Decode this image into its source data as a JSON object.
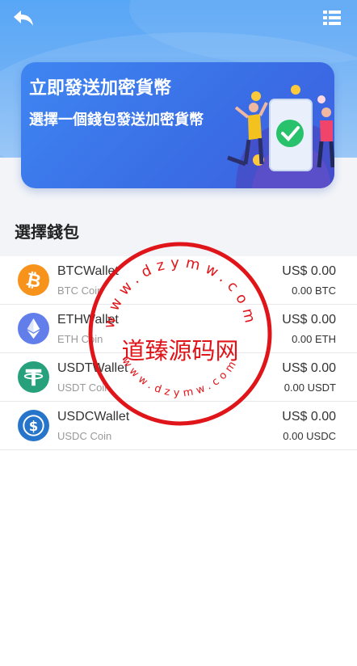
{
  "nav": {
    "back_icon": "back-arrow-icon",
    "menu_icon": "list-menu-icon"
  },
  "banner": {
    "title": "立即發送加密貨幣",
    "subtitle": "選擇一個錢包發送加密貨幣"
  },
  "section": {
    "title": "選擇錢包"
  },
  "wallets": [
    {
      "name": "BTCWallet",
      "coin": "BTC Coin",
      "balance": "US$ 0.00",
      "amount": "0.00 BTC",
      "icon": "bitcoin-icon",
      "color": "#f7931a"
    },
    {
      "name": "ETHWallet",
      "coin": "ETH Coin",
      "balance": "US$ 0.00",
      "amount": "0.00 ETH",
      "icon": "ethereum-icon",
      "color": "#627eea"
    },
    {
      "name": "USDTWallet",
      "coin": "USDT Coin",
      "balance": "US$ 0.00",
      "amount": "0.00 USDT",
      "icon": "tether-icon",
      "color": "#26a17b"
    },
    {
      "name": "USDCWallet",
      "coin": "USDC Coin",
      "balance": "US$ 0.00",
      "amount": "0.00 USDC",
      "icon": "usdc-icon",
      "color": "#2775ca"
    }
  ],
  "watermark": {
    "center": "道臻源码网",
    "ring": "www.dzymw.com"
  }
}
